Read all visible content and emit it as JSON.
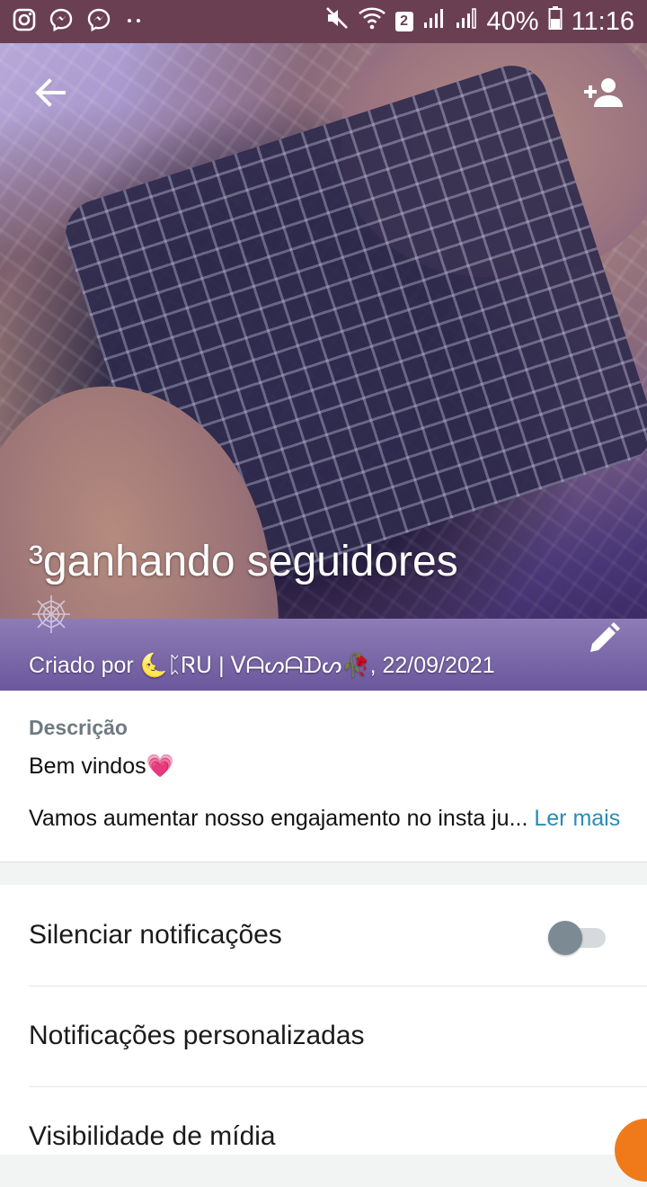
{
  "status_bar": {
    "left_icons": [
      "instagram-icon",
      "messenger-icon",
      "messenger-icon",
      "more-dots-icon"
    ],
    "right_icons": [
      "mute-icon",
      "wifi-icon",
      "sim-2-badge",
      "signal-icon",
      "signal-icon",
      "battery-icon"
    ],
    "sim_badge": "2",
    "battery": "40%",
    "time": "11:16"
  },
  "header": {
    "back_icon": "arrow-back-icon",
    "add_member_icon": "person-add-icon",
    "edit_icon": "pencil-icon",
    "title": "³ganhando seguidores",
    "title_emoji_icon": "spider-web-icon",
    "created_by": "Criado por 🌜ᛈᏒᑌ | ᐯᗩᔕᗩᗪᔕ🥀, 22/09/2021"
  },
  "description": {
    "label": "Descrição",
    "line1": "Bem vindos💗",
    "line2": "Vamos aumentar nosso engajamento no insta ju...",
    "read_more": "Ler mais"
  },
  "settings": {
    "mute_label": "Silenciar notificações",
    "mute_enabled": false,
    "custom_notifications_label": "Notificações personalizadas",
    "media_visibility_label": "Visibilidade de mídia"
  },
  "colors": {
    "status_bar": "#6b3f52",
    "link": "#2a8bb6",
    "toggle_knob": "#7c8a93",
    "fab": "#f07a1a"
  }
}
